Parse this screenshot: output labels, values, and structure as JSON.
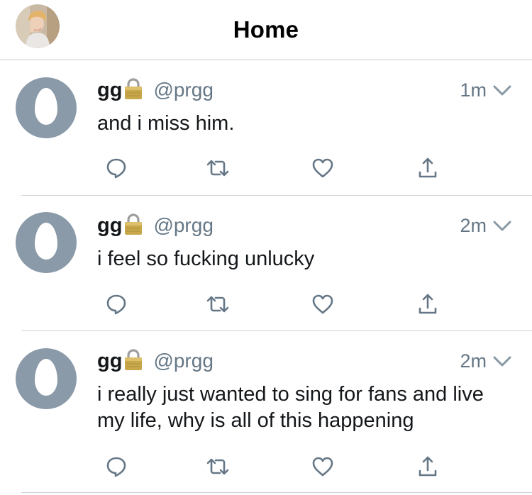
{
  "header": {
    "title": "Home"
  },
  "tweets": [
    {
      "display_name": "gg",
      "handle": "@prgg",
      "time": "1m",
      "text": "and i miss him."
    },
    {
      "display_name": "gg",
      "handle": "@prgg",
      "time": "2m",
      "text": "i feel so fucking unlucky"
    },
    {
      "display_name": "gg",
      "handle": "@prgg",
      "time": "2m",
      "text": "i really just wanted to sing for fans and live my life, why is all of this happening"
    }
  ],
  "icons": {
    "avatar": "default-egg-avatar",
    "lock": "lock-icon",
    "menu": "chevron-down-icon",
    "reply": "reply-icon",
    "retweet": "retweet-icon",
    "like": "heart-icon",
    "share": "share-icon"
  },
  "colors": {
    "text": "#14171a",
    "secondary": "#657786",
    "avatar_bg": "#8a9aa9",
    "icon": "#657786",
    "divider": "#cdd3d8"
  }
}
